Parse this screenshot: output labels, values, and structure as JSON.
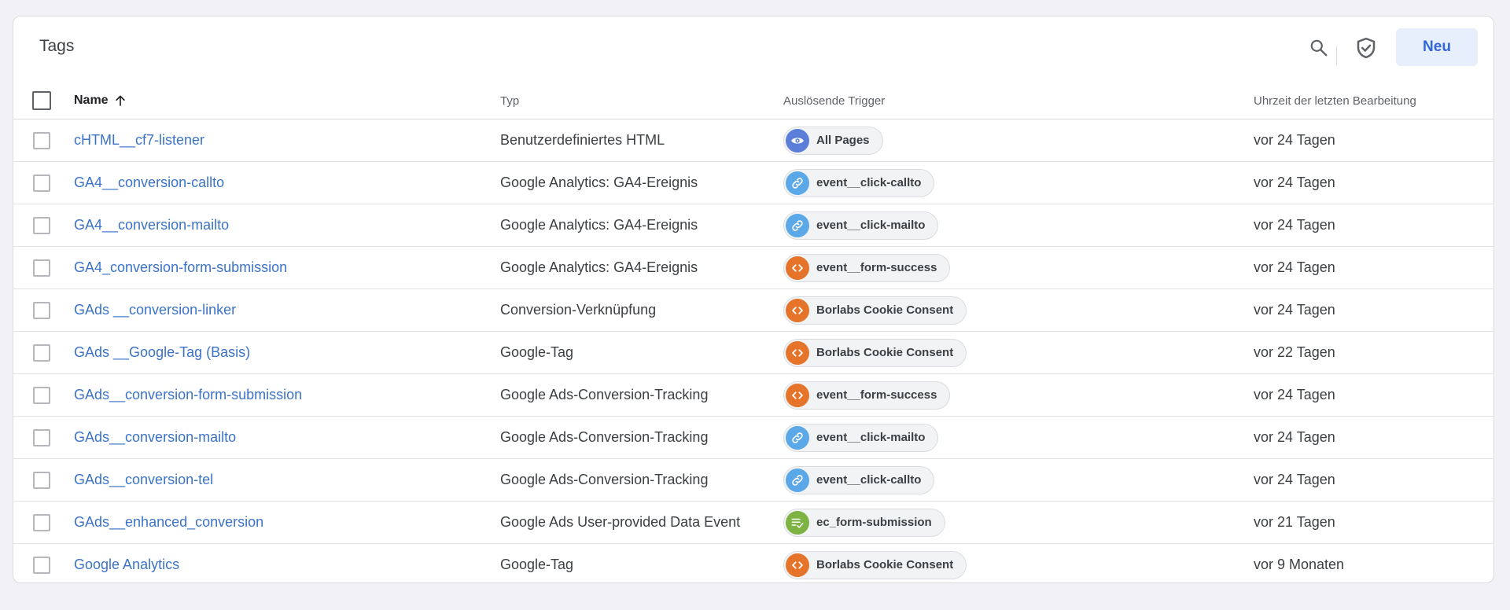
{
  "header": {
    "title": "Tags",
    "new_button": "Neu"
  },
  "columns": {
    "name": "Name",
    "type": "Typ",
    "trigger": "Auslösende Trigger",
    "time": "Uhrzeit der letzten Bearbeitung"
  },
  "trigger_colors": {
    "page-view": "#5b7fd9",
    "link-click": "#5aa8e8",
    "custom-event": "#e5742a",
    "form-submit": "#7cb342"
  },
  "rows": [
    {
      "name": "cHTML__cf7-listener",
      "type": "Benutzerdefiniertes HTML",
      "trigger": "All Pages",
      "trigger_icon": "eye-icon",
      "trigger_kind": "page-view",
      "time": "vor 24 Tagen"
    },
    {
      "name": "GA4__conversion-callto",
      "type": "Google Analytics: GA4-Ereignis",
      "trigger": "event__click-callto",
      "trigger_icon": "link-icon",
      "trigger_kind": "link-click",
      "time": "vor 24 Tagen"
    },
    {
      "name": "GA4__conversion-mailto",
      "type": "Google Analytics: GA4-Ereignis",
      "trigger": "event__click-mailto",
      "trigger_icon": "link-icon",
      "trigger_kind": "link-click",
      "time": "vor 24 Tagen"
    },
    {
      "name": "GA4_conversion-form-submission",
      "type": "Google Analytics: GA4-Ereignis",
      "trigger": "event__form-success",
      "trigger_icon": "code-icon",
      "trigger_kind": "custom-event",
      "time": "vor 24 Tagen"
    },
    {
      "name": "GAds __conversion-linker",
      "type": "Conversion-Verknüpfung",
      "trigger": "Borlabs Cookie Consent",
      "trigger_icon": "code-icon",
      "trigger_kind": "custom-event",
      "time": "vor 24 Tagen"
    },
    {
      "name": "GAds __Google-Tag (Basis)",
      "type": "Google-Tag",
      "trigger": "Borlabs Cookie Consent",
      "trigger_icon": "code-icon",
      "trigger_kind": "custom-event",
      "time": "vor 22 Tagen"
    },
    {
      "name": "GAds__conversion-form-submission",
      "type": "Google Ads-Conversion-Tracking",
      "trigger": "event__form-success",
      "trigger_icon": "code-icon",
      "trigger_kind": "custom-event",
      "time": "vor 24 Tagen"
    },
    {
      "name": "GAds__conversion-mailto",
      "type": "Google Ads-Conversion-Tracking",
      "trigger": "event__click-mailto",
      "trigger_icon": "link-icon",
      "trigger_kind": "link-click",
      "time": "vor 24 Tagen"
    },
    {
      "name": "GAds__conversion-tel",
      "type": "Google Ads-Conversion-Tracking",
      "trigger": "event__click-callto",
      "trigger_icon": "link-icon",
      "trigger_kind": "link-click",
      "time": "vor 24 Tagen"
    },
    {
      "name": "GAds__enhanced_conversion",
      "type": "Google Ads User-provided Data Event",
      "trigger": "ec_form-submission",
      "trigger_icon": "form-check-icon",
      "trigger_kind": "form-submit",
      "time": "vor 21 Tagen"
    },
    {
      "name": "Google Analytics",
      "type": "Google-Tag",
      "trigger": "Borlabs Cookie Consent",
      "trigger_icon": "code-icon",
      "trigger_kind": "custom-event",
      "time": "vor 9 Monaten"
    }
  ]
}
